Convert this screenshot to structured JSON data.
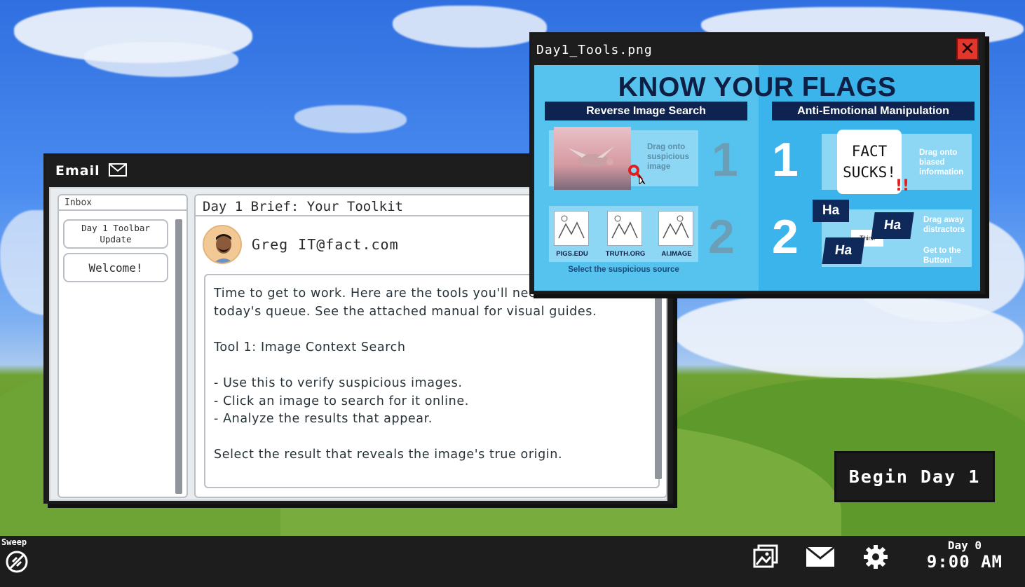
{
  "email_window": {
    "title": "Email",
    "inbox_label": "Inbox",
    "inbox_items": [
      "Day 1 Toolbar Update",
      "Welcome!"
    ],
    "subject": "Day 1 Brief: Your Toolkit",
    "sender_name": "Greg",
    "sender_email": "IT@fact.com",
    "body": "Time to get to work. Here are the tools you'll need for\ntoday's queue. See the attached manual for visual guides.\n\nTool 1: Image Context Search\n\n- Use this to verify suspicious images.\n- Click an image to search for it online.\n- Analyze the results that appear.\n\nSelect the result that reveals the image's true origin."
  },
  "tools_window": {
    "title": "Day1_Tools.png",
    "poster_title": "KNOW YOUR FLAGS",
    "left_header": "Reverse Image Search",
    "right_header": "Anti-Emotional Manipulation",
    "left_step1_text": "Drag onto suspicious image",
    "left_step_numbers": [
      "1",
      "2"
    ],
    "sources": [
      "PIGS.EDU",
      "TRUTH.ORG",
      "AI.IMAGE"
    ],
    "left_step2_caption": "Select the suspicious source",
    "right_step_numbers": [
      "1",
      "2"
    ],
    "fact_card": "FACT SUCKS!",
    "right_step1_text": "Drag onto biased information",
    "ha_labels": [
      "Ha",
      "Ha",
      "Ha"
    ],
    "think_label": "Think",
    "right_step2_text_a": "Drag away distractors",
    "right_step2_text_b": "Get to the Button!"
  },
  "begin_button": "Begin Day 1",
  "taskbar": {
    "sweep_label": "Sweep",
    "day_label": "Day 0",
    "time": "9:00 AM"
  },
  "colors": {
    "taskbar": "#1d1d1d",
    "poster_bg": "#56c3ee",
    "poster_navy": "#0f2350",
    "close_red": "#e0362c"
  },
  "icons": [
    "mail-icon",
    "close-icon",
    "photos-icon",
    "envelope-icon",
    "gear-icon",
    "sweep-icon"
  ]
}
